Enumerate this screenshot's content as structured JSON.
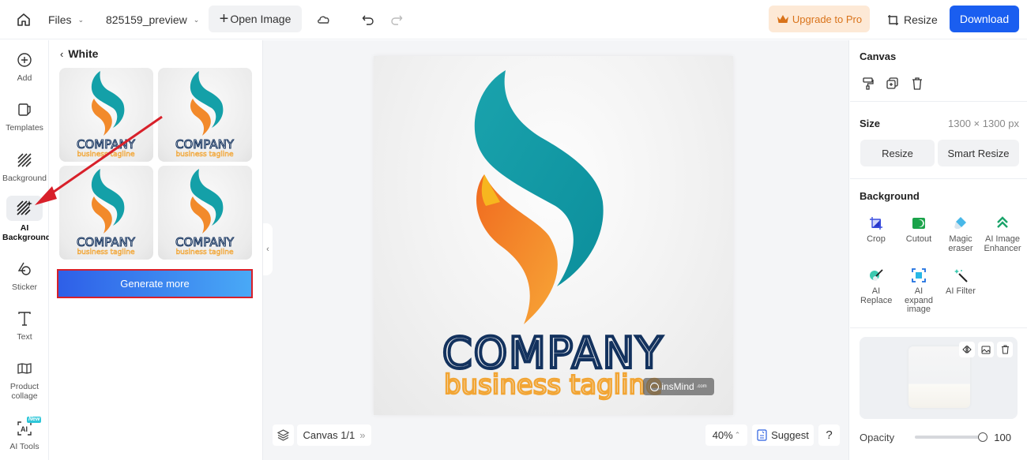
{
  "topbar": {
    "files_label": "Files",
    "filename": "825159_preview",
    "open_image_label": "Open Image",
    "upgrade_label": "Upgrade to Pro",
    "resize_label": "Resize",
    "download_label": "Download"
  },
  "leftnav": {
    "items": [
      {
        "label": "Add",
        "icon": "plus-circle-icon"
      },
      {
        "label": "Templates",
        "icon": "templates-icon"
      },
      {
        "label": "Background",
        "icon": "background-hatch-icon"
      },
      {
        "label": "AI Background",
        "icon": "ai-background-icon",
        "active": true
      },
      {
        "label": "Sticker",
        "icon": "sticker-icon"
      },
      {
        "label": "Text",
        "icon": "text-icon"
      },
      {
        "label": "Product collage",
        "icon": "collage-icon"
      },
      {
        "label": "AI Tools",
        "icon": "ai-tools-icon",
        "badge": "New"
      }
    ]
  },
  "panel": {
    "back_title": "White",
    "thumbnails": [
      {
        "title": "COMPANY",
        "tagline": "business tagline"
      },
      {
        "title": "COMPANY",
        "tagline": "business tagline"
      },
      {
        "title": "COMPANY",
        "tagline": "business tagline"
      },
      {
        "title": "COMPANY",
        "tagline": "business tagline"
      }
    ],
    "generate_label": "Generate more"
  },
  "canvas": {
    "logo_title": "COMPANY",
    "logo_tagline": "business tagline",
    "watermark": "insMind",
    "watermark_suffix": ".com",
    "canvas_label": "Canvas 1/1",
    "zoom": "40%",
    "suggest_label": "Suggest",
    "help_label": "?"
  },
  "right": {
    "canvas_title": "Canvas",
    "size_title": "Size",
    "size_value": "1300 × 1300 px",
    "resize_label": "Resize",
    "smart_resize_label": "Smart Resize",
    "background_title": "Background",
    "tools": [
      {
        "label": "Crop",
        "icon": "crop-icon",
        "color": "#3b4fe0"
      },
      {
        "label": "Cutout",
        "icon": "cutout-icon",
        "color": "#1aa34a"
      },
      {
        "label": "Magic eraser",
        "icon": "eraser-icon",
        "color": "#48b8e8"
      },
      {
        "label": "AI Image Enhancer",
        "icon": "enhancer-icon",
        "color": "#1aa36a"
      },
      {
        "label": "AI Replace",
        "icon": "ai-replace-icon",
        "color": "#3cc9b0"
      },
      {
        "label": "AI expand image",
        "icon": "ai-expand-icon",
        "color": "#1d8fe0"
      },
      {
        "label": "AI Filter",
        "icon": "ai-filter-icon",
        "color": "#333333"
      }
    ],
    "opacity_label": "Opacity",
    "opacity_value": "100",
    "opacity_fraction": 1.0
  },
  "colors": {
    "accent": "#1a5ef0",
    "upgrade_bg": "#fde9d6",
    "upgrade_text": "#d9731a",
    "highlight_red": "#d8202a",
    "logo_navy": "#13325e",
    "logo_orange": "#f2a534",
    "logo_teal": "#14a0a8"
  }
}
